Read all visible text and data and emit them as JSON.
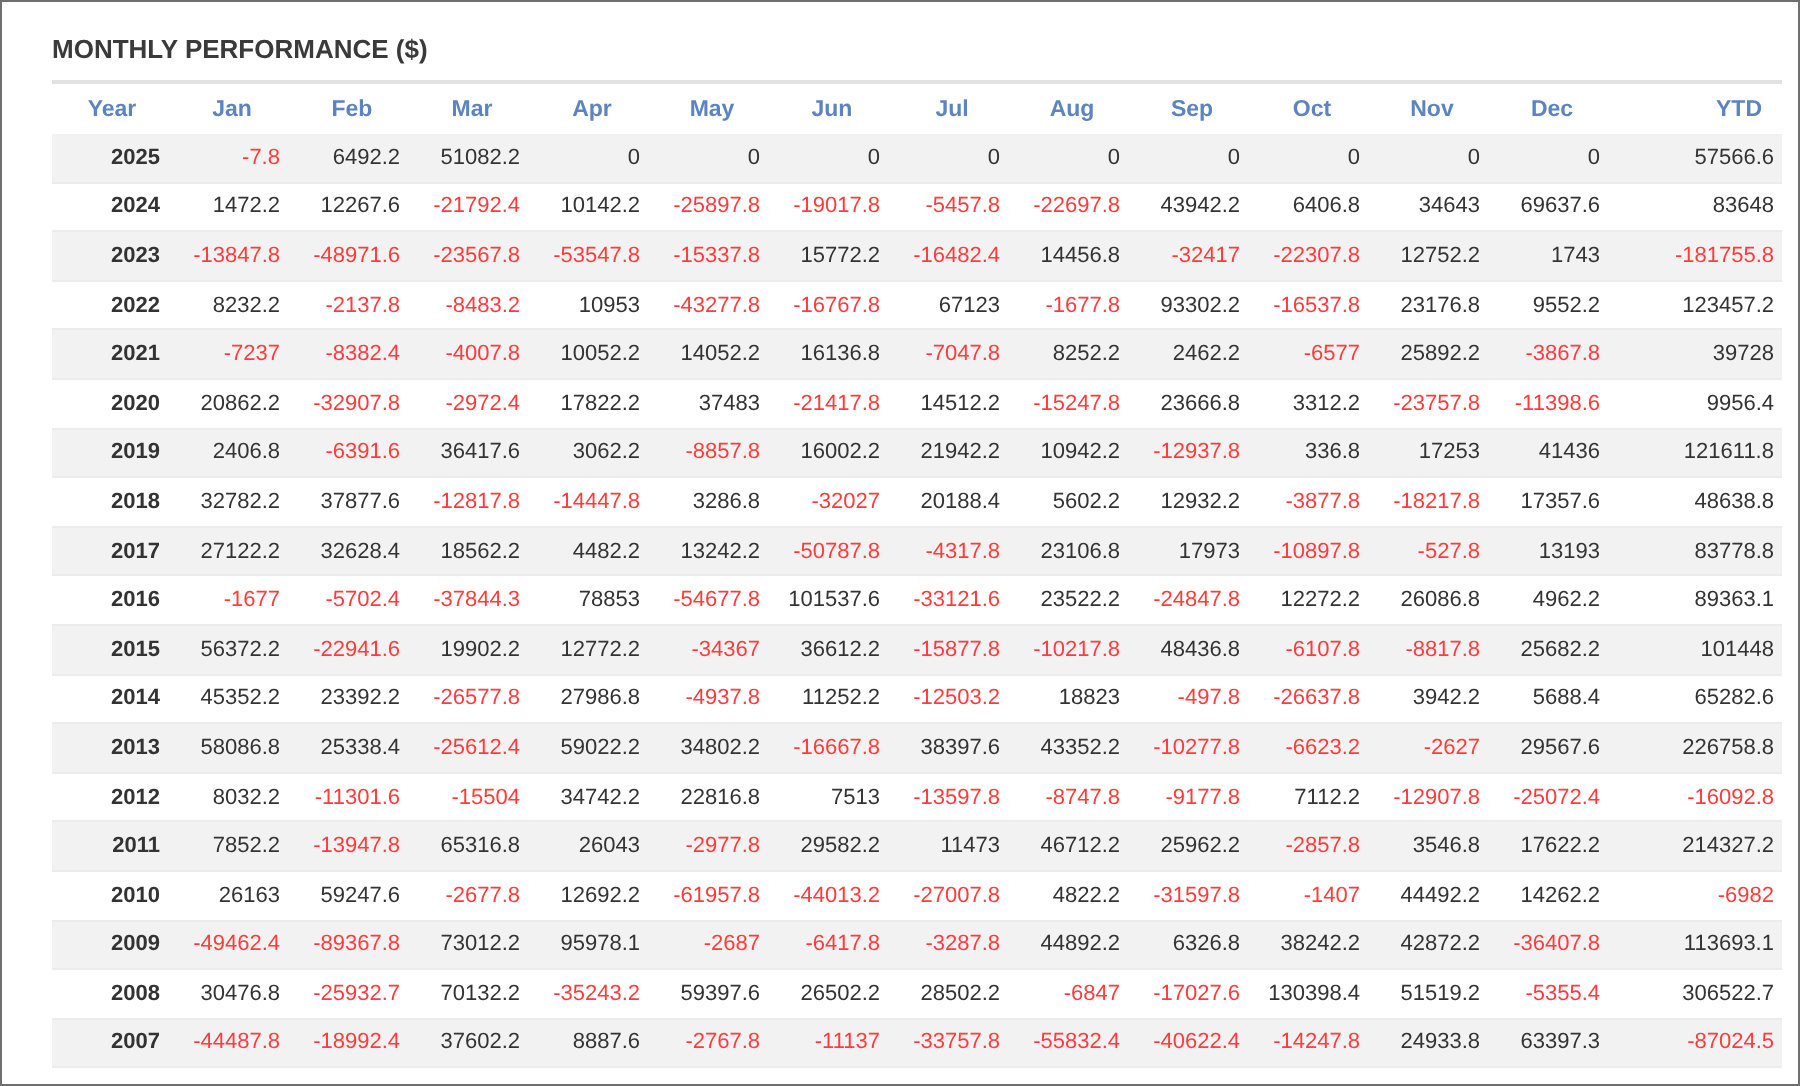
{
  "title": "MONTHLY PERFORMANCE ($)",
  "columns": [
    "Year",
    "Jan",
    "Feb",
    "Mar",
    "Apr",
    "May",
    "Jun",
    "Jul",
    "Aug",
    "Sep",
    "Oct",
    "Nov",
    "Dec",
    "YTD"
  ],
  "rows": [
    {
      "year": "2025",
      "cells": [
        {
          "value": "-7.8",
          "negative": true
        },
        {
          "value": "6492.2",
          "negative": false
        },
        {
          "value": "51082.2",
          "negative": false
        },
        {
          "value": "0",
          "negative": false
        },
        {
          "value": "0",
          "negative": false
        },
        {
          "value": "0",
          "negative": false
        },
        {
          "value": "0",
          "negative": false
        },
        {
          "value": "0",
          "negative": false
        },
        {
          "value": "0",
          "negative": false
        },
        {
          "value": "0",
          "negative": false
        },
        {
          "value": "0",
          "negative": false
        },
        {
          "value": "0",
          "negative": false
        },
        {
          "value": "57566.6",
          "negative": false
        }
      ]
    },
    {
      "year": "2024",
      "cells": [
        {
          "value": "1472.2",
          "negative": false
        },
        {
          "value": "12267.6",
          "negative": false
        },
        {
          "value": "-21792.4",
          "negative": true
        },
        {
          "value": "10142.2",
          "negative": false
        },
        {
          "value": "-25897.8",
          "negative": true
        },
        {
          "value": "-19017.8",
          "negative": true
        },
        {
          "value": "-5457.8",
          "negative": true
        },
        {
          "value": "-22697.8",
          "negative": true
        },
        {
          "value": "43942.2",
          "negative": false
        },
        {
          "value": "6406.8",
          "negative": false
        },
        {
          "value": "34643",
          "negative": false
        },
        {
          "value": "69637.6",
          "negative": false
        },
        {
          "value": "83648",
          "negative": false
        }
      ]
    },
    {
      "year": "2023",
      "cells": [
        {
          "value": "-13847.8",
          "negative": true
        },
        {
          "value": "-48971.6",
          "negative": true
        },
        {
          "value": "-23567.8",
          "negative": true
        },
        {
          "value": "-53547.8",
          "negative": true
        },
        {
          "value": "-15337.8",
          "negative": true
        },
        {
          "value": "15772.2",
          "negative": false
        },
        {
          "value": "-16482.4",
          "negative": true
        },
        {
          "value": "14456.8",
          "negative": false
        },
        {
          "value": "-32417",
          "negative": true
        },
        {
          "value": "-22307.8",
          "negative": true
        },
        {
          "value": "12752.2",
          "negative": false
        },
        {
          "value": "1743",
          "negative": false
        },
        {
          "value": "-181755.8",
          "negative": true
        }
      ]
    },
    {
      "year": "2022",
      "cells": [
        {
          "value": "8232.2",
          "negative": false
        },
        {
          "value": "-2137.8",
          "negative": true
        },
        {
          "value": "-8483.2",
          "negative": true
        },
        {
          "value": "10953",
          "negative": false
        },
        {
          "value": "-43277.8",
          "negative": true
        },
        {
          "value": "-16767.8",
          "negative": true
        },
        {
          "value": "67123",
          "negative": false
        },
        {
          "value": "-1677.8",
          "negative": true
        },
        {
          "value": "93302.2",
          "negative": false
        },
        {
          "value": "-16537.8",
          "negative": true
        },
        {
          "value": "23176.8",
          "negative": false
        },
        {
          "value": "9552.2",
          "negative": false
        },
        {
          "value": "123457.2",
          "negative": false
        }
      ]
    },
    {
      "year": "2021",
      "cells": [
        {
          "value": "-7237",
          "negative": true
        },
        {
          "value": "-8382.4",
          "negative": true
        },
        {
          "value": "-4007.8",
          "negative": true
        },
        {
          "value": "10052.2",
          "negative": false
        },
        {
          "value": "14052.2",
          "negative": false
        },
        {
          "value": "16136.8",
          "negative": false
        },
        {
          "value": "-7047.8",
          "negative": true
        },
        {
          "value": "8252.2",
          "negative": false
        },
        {
          "value": "2462.2",
          "negative": false
        },
        {
          "value": "-6577",
          "negative": true
        },
        {
          "value": "25892.2",
          "negative": false
        },
        {
          "value": "-3867.8",
          "negative": true
        },
        {
          "value": "39728",
          "negative": false
        }
      ]
    },
    {
      "year": "2020",
      "cells": [
        {
          "value": "20862.2",
          "negative": false
        },
        {
          "value": "-32907.8",
          "negative": true
        },
        {
          "value": "-2972.4",
          "negative": true
        },
        {
          "value": "17822.2",
          "negative": false
        },
        {
          "value": "37483",
          "negative": false
        },
        {
          "value": "-21417.8",
          "negative": true
        },
        {
          "value": "14512.2",
          "negative": false
        },
        {
          "value": "-15247.8",
          "negative": true
        },
        {
          "value": "23666.8",
          "negative": false
        },
        {
          "value": "3312.2",
          "negative": false
        },
        {
          "value": "-23757.8",
          "negative": true
        },
        {
          "value": "-11398.6",
          "negative": true
        },
        {
          "value": "9956.4",
          "negative": false
        }
      ]
    },
    {
      "year": "2019",
      "cells": [
        {
          "value": "2406.8",
          "negative": false
        },
        {
          "value": "-6391.6",
          "negative": true
        },
        {
          "value": "36417.6",
          "negative": false
        },
        {
          "value": "3062.2",
          "negative": false
        },
        {
          "value": "-8857.8",
          "negative": true
        },
        {
          "value": "16002.2",
          "negative": false
        },
        {
          "value": "21942.2",
          "negative": false
        },
        {
          "value": "10942.2",
          "negative": false
        },
        {
          "value": "-12937.8",
          "negative": true
        },
        {
          "value": "336.8",
          "negative": false
        },
        {
          "value": "17253",
          "negative": false
        },
        {
          "value": "41436",
          "negative": false
        },
        {
          "value": "121611.8",
          "negative": false
        }
      ]
    },
    {
      "year": "2018",
      "cells": [
        {
          "value": "32782.2",
          "negative": false
        },
        {
          "value": "37877.6",
          "negative": false
        },
        {
          "value": "-12817.8",
          "negative": true
        },
        {
          "value": "-14447.8",
          "negative": true
        },
        {
          "value": "3286.8",
          "negative": false
        },
        {
          "value": "-32027",
          "negative": true
        },
        {
          "value": "20188.4",
          "negative": false
        },
        {
          "value": "5602.2",
          "negative": false
        },
        {
          "value": "12932.2",
          "negative": false
        },
        {
          "value": "-3877.8",
          "negative": true
        },
        {
          "value": "-18217.8",
          "negative": true
        },
        {
          "value": "17357.6",
          "negative": false
        },
        {
          "value": "48638.8",
          "negative": false
        }
      ]
    },
    {
      "year": "2017",
      "cells": [
        {
          "value": "27122.2",
          "negative": false
        },
        {
          "value": "32628.4",
          "negative": false
        },
        {
          "value": "18562.2",
          "negative": false
        },
        {
          "value": "4482.2",
          "negative": false
        },
        {
          "value": "13242.2",
          "negative": false
        },
        {
          "value": "-50787.8",
          "negative": true
        },
        {
          "value": "-4317.8",
          "negative": true
        },
        {
          "value": "23106.8",
          "negative": false
        },
        {
          "value": "17973",
          "negative": false
        },
        {
          "value": "-10897.8",
          "negative": true
        },
        {
          "value": "-527.8",
          "negative": true
        },
        {
          "value": "13193",
          "negative": false
        },
        {
          "value": "83778.8",
          "negative": false
        }
      ]
    },
    {
      "year": "2016",
      "cells": [
        {
          "value": "-1677",
          "negative": true
        },
        {
          "value": "-5702.4",
          "negative": true
        },
        {
          "value": "-37844.3",
          "negative": true
        },
        {
          "value": "78853",
          "negative": false
        },
        {
          "value": "-54677.8",
          "negative": true
        },
        {
          "value": "101537.6",
          "negative": false
        },
        {
          "value": "-33121.6",
          "negative": true
        },
        {
          "value": "23522.2",
          "negative": false
        },
        {
          "value": "-24847.8",
          "negative": true
        },
        {
          "value": "12272.2",
          "negative": false
        },
        {
          "value": "26086.8",
          "negative": false
        },
        {
          "value": "4962.2",
          "negative": false
        },
        {
          "value": "89363.1",
          "negative": false
        }
      ]
    },
    {
      "year": "2015",
      "cells": [
        {
          "value": "56372.2",
          "negative": false
        },
        {
          "value": "-22941.6",
          "negative": true
        },
        {
          "value": "19902.2",
          "negative": false
        },
        {
          "value": "12772.2",
          "negative": false
        },
        {
          "value": "-34367",
          "negative": true
        },
        {
          "value": "36612.2",
          "negative": false
        },
        {
          "value": "-15877.8",
          "negative": true
        },
        {
          "value": "-10217.8",
          "negative": true
        },
        {
          "value": "48436.8",
          "negative": false
        },
        {
          "value": "-6107.8",
          "negative": true
        },
        {
          "value": "-8817.8",
          "negative": true
        },
        {
          "value": "25682.2",
          "negative": false
        },
        {
          "value": "101448",
          "negative": false
        }
      ]
    },
    {
      "year": "2014",
      "cells": [
        {
          "value": "45352.2",
          "negative": false
        },
        {
          "value": "23392.2",
          "negative": false
        },
        {
          "value": "-26577.8",
          "negative": true
        },
        {
          "value": "27986.8",
          "negative": false
        },
        {
          "value": "-4937.8",
          "negative": true
        },
        {
          "value": "11252.2",
          "negative": false
        },
        {
          "value": "-12503.2",
          "negative": true
        },
        {
          "value": "18823",
          "negative": false
        },
        {
          "value": "-497.8",
          "negative": true
        },
        {
          "value": "-26637.8",
          "negative": true
        },
        {
          "value": "3942.2",
          "negative": false
        },
        {
          "value": "5688.4",
          "negative": false
        },
        {
          "value": "65282.6",
          "negative": false
        }
      ]
    },
    {
      "year": "2013",
      "cells": [
        {
          "value": "58086.8",
          "negative": false
        },
        {
          "value": "25338.4",
          "negative": false
        },
        {
          "value": "-25612.4",
          "negative": true
        },
        {
          "value": "59022.2",
          "negative": false
        },
        {
          "value": "34802.2",
          "negative": false
        },
        {
          "value": "-16667.8",
          "negative": true
        },
        {
          "value": "38397.6",
          "negative": false
        },
        {
          "value": "43352.2",
          "negative": false
        },
        {
          "value": "-10277.8",
          "negative": true
        },
        {
          "value": "-6623.2",
          "negative": true
        },
        {
          "value": "-2627",
          "negative": true
        },
        {
          "value": "29567.6",
          "negative": false
        },
        {
          "value": "226758.8",
          "negative": false
        }
      ]
    },
    {
      "year": "2012",
      "cells": [
        {
          "value": "8032.2",
          "negative": false
        },
        {
          "value": "-11301.6",
          "negative": true
        },
        {
          "value": "-15504",
          "negative": true
        },
        {
          "value": "34742.2",
          "negative": false
        },
        {
          "value": "22816.8",
          "negative": false
        },
        {
          "value": "7513",
          "negative": false
        },
        {
          "value": "-13597.8",
          "negative": true
        },
        {
          "value": "-8747.8",
          "negative": true
        },
        {
          "value": "-9177.8",
          "negative": true
        },
        {
          "value": "7112.2",
          "negative": false
        },
        {
          "value": "-12907.8",
          "negative": true
        },
        {
          "value": "-25072.4",
          "negative": true
        },
        {
          "value": "-16092.8",
          "negative": true
        }
      ]
    },
    {
      "year": "2011",
      "cells": [
        {
          "value": "7852.2",
          "negative": false
        },
        {
          "value": "-13947.8",
          "negative": true
        },
        {
          "value": "65316.8",
          "negative": false
        },
        {
          "value": "26043",
          "negative": false
        },
        {
          "value": "-2977.8",
          "negative": true
        },
        {
          "value": "29582.2",
          "negative": false
        },
        {
          "value": "11473",
          "negative": false
        },
        {
          "value": "46712.2",
          "negative": false
        },
        {
          "value": "25962.2",
          "negative": false
        },
        {
          "value": "-2857.8",
          "negative": true
        },
        {
          "value": "3546.8",
          "negative": false
        },
        {
          "value": "17622.2",
          "negative": false
        },
        {
          "value": "214327.2",
          "negative": false
        }
      ]
    },
    {
      "year": "2010",
      "cells": [
        {
          "value": "26163",
          "negative": false
        },
        {
          "value": "59247.6",
          "negative": false
        },
        {
          "value": "-2677.8",
          "negative": true
        },
        {
          "value": "12692.2",
          "negative": false
        },
        {
          "value": "-61957.8",
          "negative": true
        },
        {
          "value": "-44013.2",
          "negative": true
        },
        {
          "value": "-27007.8",
          "negative": true
        },
        {
          "value": "4822.2",
          "negative": false
        },
        {
          "value": "-31597.8",
          "negative": true
        },
        {
          "value": "-1407",
          "negative": true
        },
        {
          "value": "44492.2",
          "negative": false
        },
        {
          "value": "14262.2",
          "negative": false
        },
        {
          "value": "-6982",
          "negative": true
        }
      ]
    },
    {
      "year": "2009",
      "cells": [
        {
          "value": "-49462.4",
          "negative": true
        },
        {
          "value": "-89367.8",
          "negative": true
        },
        {
          "value": "73012.2",
          "negative": false
        },
        {
          "value": "95978.1",
          "negative": false
        },
        {
          "value": "-2687",
          "negative": true
        },
        {
          "value": "-6417.8",
          "negative": true
        },
        {
          "value": "-3287.8",
          "negative": true
        },
        {
          "value": "44892.2",
          "negative": false
        },
        {
          "value": "6326.8",
          "negative": false
        },
        {
          "value": "38242.2",
          "negative": false
        },
        {
          "value": "42872.2",
          "negative": false
        },
        {
          "value": "-36407.8",
          "negative": true
        },
        {
          "value": "113693.1",
          "negative": false
        }
      ]
    },
    {
      "year": "2008",
      "cells": [
        {
          "value": "30476.8",
          "negative": false
        },
        {
          "value": "-25932.7",
          "negative": true
        },
        {
          "value": "70132.2",
          "negative": false
        },
        {
          "value": "-35243.2",
          "negative": true
        },
        {
          "value": "59397.6",
          "negative": false
        },
        {
          "value": "26502.2",
          "negative": false
        },
        {
          "value": "28502.2",
          "negative": false
        },
        {
          "value": "-6847",
          "negative": true
        },
        {
          "value": "-17027.6",
          "negative": true
        },
        {
          "value": "130398.4",
          "negative": false
        },
        {
          "value": "51519.2",
          "negative": false
        },
        {
          "value": "-5355.4",
          "negative": true
        },
        {
          "value": "306522.7",
          "negative": false
        }
      ]
    },
    {
      "year": "2007",
      "cells": [
        {
          "value": "-44487.8",
          "negative": true
        },
        {
          "value": "-18992.4",
          "negative": true
        },
        {
          "value": "37602.2",
          "negative": false
        },
        {
          "value": "8887.6",
          "negative": false
        },
        {
          "value": "-2767.8",
          "negative": true
        },
        {
          "value": "-11137",
          "negative": true
        },
        {
          "value": "-33757.8",
          "negative": true
        },
        {
          "value": "-55832.4",
          "negative": true
        },
        {
          "value": "-40622.4",
          "negative": true
        },
        {
          "value": "-14247.8",
          "negative": true
        },
        {
          "value": "24933.8",
          "negative": false
        },
        {
          "value": "63397.3",
          "negative": false
        },
        {
          "value": "-87024.5",
          "negative": true
        }
      ]
    }
  ]
}
